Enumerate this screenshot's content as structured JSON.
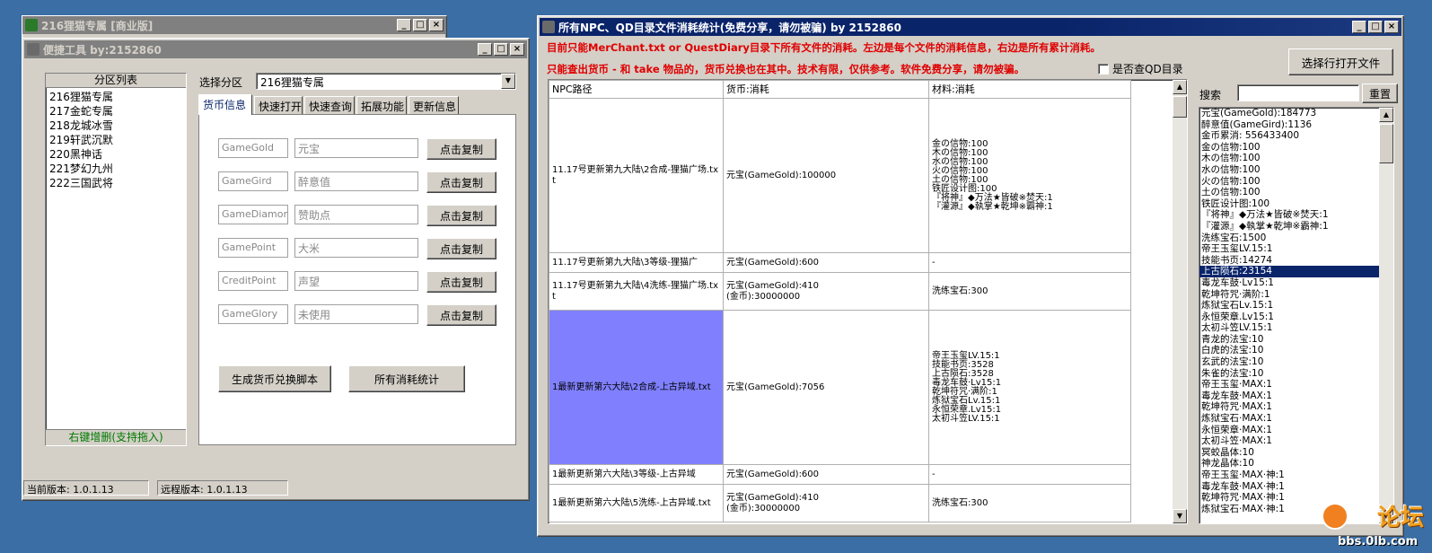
{
  "win_back": {
    "title": "216狸猫专属 [商业版]"
  },
  "win_tool": {
    "title": "便捷工具  by:2152860",
    "partition_list_header": "分区列表",
    "partitions": [
      "216狸猫专属",
      "217金蛇专属",
      "218龙城冰雪",
      "219轩武沉默",
      "220黑神话",
      "221梦幻九州",
      "222三国武将"
    ],
    "partition_footer": "右键增删(支持拖入)",
    "select_partition_label": "选择分区",
    "selected_partition": "216狸猫专属",
    "tabs": [
      "货币信息",
      "快速打开",
      "快速查询",
      "拓展功能",
      "更新信息"
    ],
    "currency_rows": [
      {
        "code": "GameGold",
        "name": "元宝",
        "button": "点击复制"
      },
      {
        "code": "GameGird",
        "name": "醉意值",
        "button": "点击复制"
      },
      {
        "code": "GameDiamond",
        "name": "赞助点",
        "button": "点击复制"
      },
      {
        "code": "GamePoint",
        "name": "大米",
        "button": "点击复制"
      },
      {
        "code": "CreditPoint",
        "name": "声望",
        "button": "点击复制"
      },
      {
        "code": "GameGlory",
        "name": "未使用",
        "button": "点击复制"
      }
    ],
    "gen_script_button": "生成货币兑换脚本",
    "all_stats_button": "所有消耗统计",
    "current_version": "当前版本: 1.0.1.13",
    "remote_version": "远程版本: 1.0.1.13"
  },
  "win_stats": {
    "title": "所有NPC、QD目录文件消耗统计(免费分享，请勿被骗)    by 2152860",
    "notice1": "目前只能MerChant.txt or QuestDiary目录下所有文件的消耗。左边是每个文件的消耗信息，右边是所有累计消耗。",
    "notice2": "只能查出货币 - 和 take 物品的，货币兑换也在其中。技术有限，仅供参考。软件免费分享，请勿被骗。",
    "qd_checkbox_label": "是否查QD目录",
    "open_file_button": "选择行打开文件",
    "search_label": "搜索",
    "reset_button": "重置",
    "columns": [
      "NPC路径",
      "货币:消耗",
      "材料:消耗"
    ],
    "rows": [
      {
        "path": "11.17号更新第九大陆\\2合成-狸猫广场.txt",
        "currency": [
          "元宝(GameGold):100000"
        ],
        "materials": [
          "金の信物:100",
          "木の信物:100",
          "水の信物:100",
          "火の信物:100",
          "土の信物:100",
          "铁匠设计图:100",
          "『将神』◆万法★皆破※焚天:1",
          "『灌源』◆執掌★乾坤※霸神:1"
        ]
      },
      {
        "path": "11.17号更新第九大陆\\3等级-狸猫广",
        "currency": [
          "元宝(GameGold):600"
        ],
        "materials": [
          "-"
        ]
      },
      {
        "path": "11.17号更新第九大陆\\4洗练-狸猫广场.txt",
        "currency": [
          "元宝(GameGold):410",
          "(金币):30000000"
        ],
        "materials": [
          "洗练宝石:300"
        ]
      },
      {
        "path": "1最新更新第六大陆\\2合成-上古异域.txt",
        "currency": [
          "元宝(GameGold):7056"
        ],
        "materials": [
          "帝王玉玺LV.15:1",
          "技能书页:3528",
          "上古陨石:3528",
          "毒龙车鼓·Lv15:1",
          "乾坤符咒·满阶:1",
          "炼狱宝石Lv.15:1",
          "永恒荣章.Lv15:1",
          "太初斗笠LV.15:1"
        ]
      },
      {
        "path": "1最新更新第六大陆\\3等级-上古异域",
        "currency": [
          "元宝(GameGold):600"
        ],
        "materials": [
          "-"
        ]
      },
      {
        "path": "1最新更新第六大陆\\5洗练-上古异域.txt",
        "currency": [
          "元宝(GameGold):410",
          "(金币):30000000"
        ],
        "materials": [
          "洗练宝石:300"
        ]
      }
    ],
    "totals": [
      "元宝(GameGold):184773",
      "醉意值(GameGird):1136",
      "金币累消: 556433400",
      "金の信物:100",
      "木の信物:100",
      "水の信物:100",
      "火の信物:100",
      "土の信物:100",
      "铁匠设计图:100",
      "『将神』◆万法★皆破※焚天:1",
      "『灌源』◆執掌★乾坤※霸神:1",
      "洗练宝石:1500",
      "帝王玉玺LV.15:1",
      "技能书页:14274",
      "上古陨石:23154",
      "毒龙车鼓·Lv15:1",
      "乾坤符咒·满阶:1",
      "炼狱宝石Lv.15:1",
      "永恒荣章.Lv15:1",
      "太初斗笠LV.15:1",
      "青龙的法宝:10",
      "白虎的法宝:10",
      "玄武的法宝:10",
      "朱雀的法宝:10",
      "帝王玉玺·MAX:1",
      "毒龙车鼓·MAX:1",
      "乾坤符咒·MAX:1",
      "炼狱宝石·MAX:1",
      "永恒荣章·MAX:1",
      "太初斗笠·MAX:1",
      "冥蛟晶体:10",
      "神龙晶体:10",
      "帝王玉玺·MAX·神:1",
      "毒龙车鼓·MAX·神:1",
      "乾坤符咒·MAX·神:1",
      "炼狱宝石·MAX·神:1"
    ],
    "selected_total_index": 14
  },
  "watermark": {
    "text": "bbs.0lb.com",
    "brand": "论坛"
  }
}
